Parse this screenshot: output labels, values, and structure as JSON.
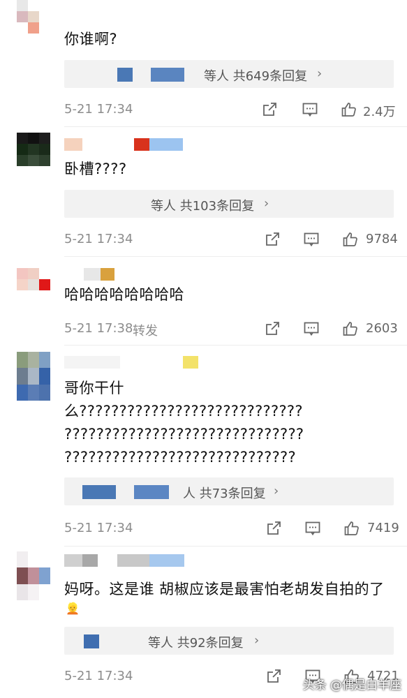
{
  "comments": [
    {
      "text": "你谁啊?",
      "reply_text": "等人  共649条回复",
      "time": "5-21 17:34",
      "forward": "",
      "likes": "2.4万"
    },
    {
      "text": "卧槽????",
      "reply_text": "等人  共103条回复",
      "time": "5-21 17:34",
      "forward": "",
      "likes": "9784"
    },
    {
      "text": "哈哈哈哈哈哈哈哈",
      "reply_text": "",
      "time": "5-21 17:38",
      "forward": "转发",
      "likes": "2603"
    },
    {
      "text_lines": [
        "哥你干什",
        "么????????????????????????????",
        "??????????????????????????????",
        "?????????????????????????????"
      ],
      "reply_text": "人  共73条回复",
      "time": "5-21 17:34",
      "forward": "",
      "likes": "7419"
    },
    {
      "text": "妈呀。这是谁 胡椒应该是最害怕老胡发自拍的了",
      "emoji": "👱",
      "reply_text": "等人  共92条回复",
      "time": "5-21 17:34",
      "forward": "",
      "likes": "4721"
    }
  ],
  "icons": {
    "chevron": "›",
    "share": "share-icon",
    "comment": "comment-icon",
    "like": "like-icon"
  },
  "watermark": "头条 @偶是白羊座",
  "colors": {
    "mosaic_blue": "#4a78b5",
    "mosaic_light_blue": "#8cb6e6",
    "meta_gray": "#8c8c8c",
    "reply_bg": "#f2f2f2"
  }
}
